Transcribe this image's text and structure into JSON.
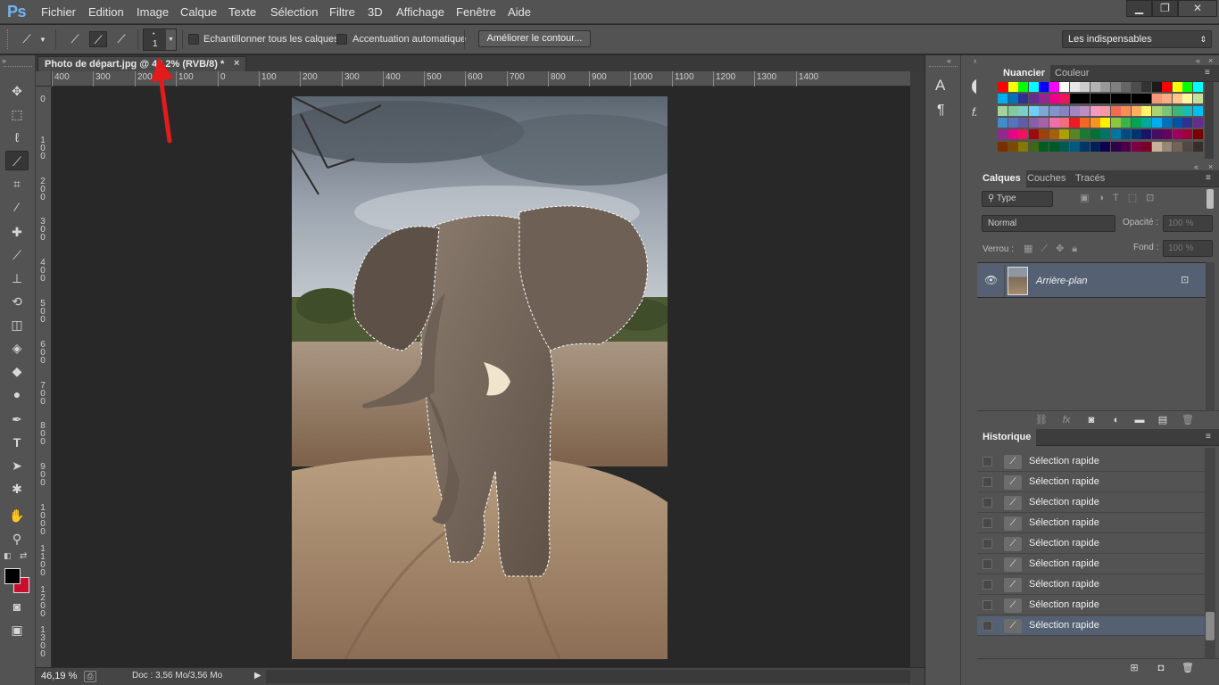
{
  "app": {
    "logo": "Ps"
  },
  "menu": {
    "items": [
      "Fichier",
      "Edition",
      "Image",
      "Calque",
      "Texte",
      "Sélection",
      "Filtre",
      "3D",
      "Affichage",
      "Fenêtre",
      "Aide"
    ]
  },
  "window_controls": {
    "minimize": "▁",
    "restore": "❐",
    "close": "✕"
  },
  "options": {
    "brush_size": "1",
    "sample_all_layers": "Echantillonner tous les calques",
    "auto_enhance": "Accentuation automatique",
    "refine_edge": "Améliorer le contour...",
    "workspace": "Les indispensables"
  },
  "document": {
    "tab_title": "Photo de départ.jpg @ 46,2% (RVB/8) *",
    "zoom": "46,19 %",
    "doc_info": "Doc : 3,56 Mo/3,56 Mo"
  },
  "rulers": {
    "h": [
      "400",
      "300",
      "200",
      "100",
      "0",
      "100",
      "200",
      "300",
      "400",
      "500",
      "600",
      "700",
      "800",
      "900",
      "1000",
      "1100",
      "1200",
      "1300",
      "1400"
    ],
    "v": [
      "0",
      "1 0 0",
      "2 0 0",
      "3 0 0",
      "4 0 0",
      "5 0 0",
      "6 0 0",
      "7 0 0",
      "8 0 0",
      "9 0 0",
      "1 0 0 0",
      "1 1 0 0",
      "1 2 0 0",
      "1 3 0 0"
    ]
  },
  "swatches_panel": {
    "tabs": [
      "Nuancier",
      "Couleur"
    ]
  },
  "layers_panel": {
    "tabs": [
      "Calques",
      "Couches",
      "Tracés"
    ],
    "filter_label": "Type",
    "blend_mode": "Normal",
    "opacity_label": "Opacité :",
    "opacity_value": "100 %",
    "lock_label": "Verrou :",
    "fill_label": "Fond :",
    "fill_value": "100 %",
    "layer_name": "Arrière-plan"
  },
  "history_panel": {
    "tab": "Historique",
    "items": [
      "Sélection rapide",
      "Sélection rapide",
      "Sélection rapide",
      "Sélection rapide",
      "Sélection rapide",
      "Sélection rapide",
      "Sélection rapide",
      "Sélection rapide",
      "Sélection rapide",
      "Sélection rapide"
    ]
  },
  "colors": {
    "accent_selected": "#556072",
    "foreground": "#000000",
    "background": "#c8102e"
  }
}
